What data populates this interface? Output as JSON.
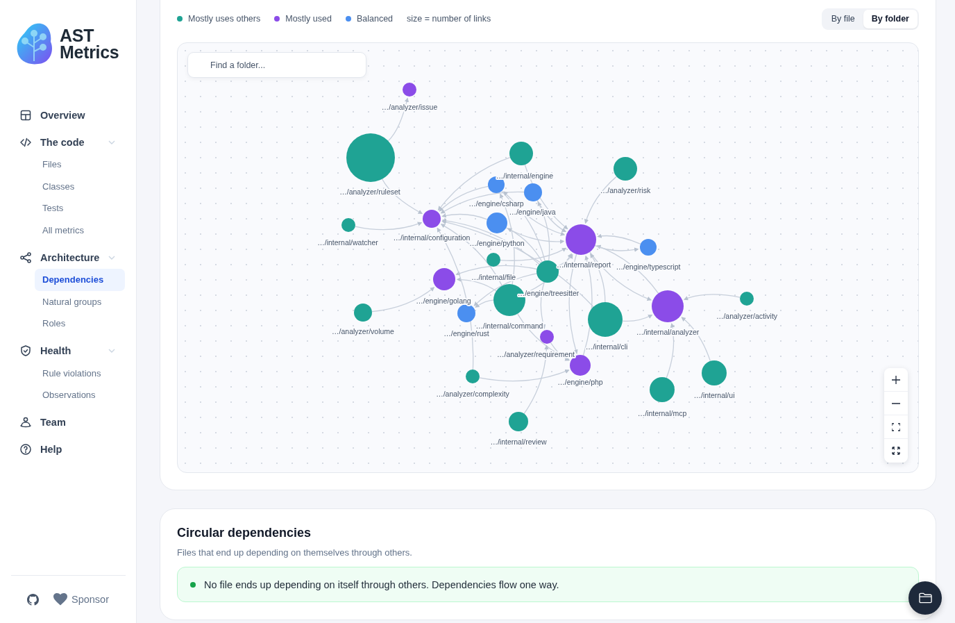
{
  "sidebar": {
    "brand": "AST Metrics",
    "items": [
      {
        "label": "Overview",
        "selected": false
      },
      {
        "label": "The code",
        "selected": false,
        "expanded": true,
        "children": [
          {
            "label": "Files",
            "selected": false
          },
          {
            "label": "Classes",
            "selected": false
          },
          {
            "label": "Tests",
            "selected": false
          },
          {
            "label": "All metrics",
            "selected": false
          }
        ]
      },
      {
        "label": "Architecture",
        "selected": false,
        "expanded": true,
        "children": [
          {
            "label": "Dependencies",
            "selected": true
          },
          {
            "label": "Natural groups",
            "selected": false
          },
          {
            "label": "Roles",
            "selected": false
          }
        ]
      },
      {
        "label": "Health",
        "selected": false,
        "expanded": true,
        "children": [
          {
            "label": "Rule violations",
            "selected": false
          },
          {
            "label": "Observations",
            "selected": false
          }
        ]
      },
      {
        "label": "Team",
        "selected": false
      },
      {
        "label": "Help",
        "selected": false
      }
    ],
    "sponsor": "Sponsor"
  },
  "legend": {
    "items": [
      {
        "label": "Mostly uses others",
        "color": "#1fa394"
      },
      {
        "label": "Mostly used",
        "color": "#8b4ce8"
      },
      {
        "label": "Balanced",
        "color": "#4b8ff0"
      }
    ],
    "note": "size = number of links"
  },
  "view_toggle": [
    {
      "label": "By file",
      "selected": false
    },
    {
      "label": "By folder",
      "selected": true
    }
  ],
  "graph": {
    "search": {
      "placeholder": "Find a folder..."
    },
    "nodes": [
      {
        "label": "…/analyzer/issue",
        "color": "#8b4ce8"
      },
      {
        "label": "…/analyzer/ruleset",
        "color": "#1fa394"
      },
      {
        "label": "…/internal/engine",
        "color": "#1fa394"
      },
      {
        "label": "…/engine/csharp",
        "color": "#4b8ff0"
      },
      {
        "label": "…/engine/java",
        "color": "#4b8ff0"
      },
      {
        "label": "…/analyzer/risk",
        "color": "#1fa394"
      },
      {
        "label": "…/internal/watcher",
        "color": "#1fa394"
      },
      {
        "label": "…/internal/configuration",
        "color": "#8b4ce8"
      },
      {
        "label": "…/engine/python",
        "color": "#4b8ff0"
      },
      {
        "label": "…/internal/report",
        "color": "#8b4ce8"
      },
      {
        "label": "…/engine/typescript",
        "color": "#4b8ff0"
      },
      {
        "label": "…/internal/file",
        "color": "#1fa394"
      },
      {
        "label": "…/engine/treesitter",
        "color": "#1fa394"
      },
      {
        "label": "…/engine/golang",
        "color": "#8b4ce8"
      },
      {
        "label": "…/internal/command",
        "color": "#1fa394"
      },
      {
        "label": "…/engine/rust",
        "color": "#4b8ff0"
      },
      {
        "label": "…/internal/cli",
        "color": "#1fa394"
      },
      {
        "label": "…/internal/analyzer",
        "color": "#8b4ce8"
      },
      {
        "label": "…/analyzer/activity",
        "color": "#1fa394"
      },
      {
        "label": "…/analyzer/volume",
        "color": "#1fa394"
      },
      {
        "label": "…/analyzer/requirement",
        "color": "#8b4ce8"
      },
      {
        "label": "…/engine/php",
        "color": "#8b4ce8"
      },
      {
        "label": "…/analyzer/complexity",
        "color": "#1fa394"
      },
      {
        "label": "…/internal/mcp",
        "color": "#1fa394"
      },
      {
        "label": "…/internal/ui",
        "color": "#1fa394"
      },
      {
        "label": "…/internal/review",
        "color": "#1fa394"
      }
    ]
  },
  "circular": {
    "title": "Circular dependencies",
    "subtitle": "Files that end up depending on themselves through others.",
    "message": "No file ends up depending on itself through others. Dependencies flow one way."
  }
}
